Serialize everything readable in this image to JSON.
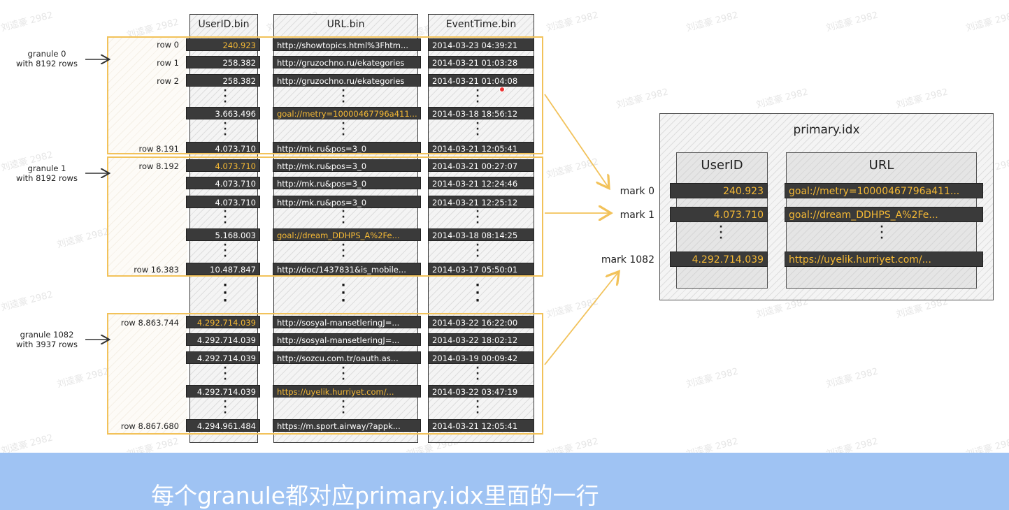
{
  "columns": [
    "UserID.bin",
    "URL.bin",
    "EventTime.bin"
  ],
  "granules": [
    {
      "label_line1": "granule 0",
      "label_line2": "with 8192 rows",
      "rows": [
        {
          "row": "row 0",
          "user": "240.923",
          "url": "http://showtopics.html%3Fhtm...",
          "time": "2014-03-23 04:39:21",
          "hl_user": true,
          "hl_url": false
        },
        {
          "row": "row 1",
          "user": "258.382",
          "url": "http://gruzochno.ru/ekategories",
          "time": "2014-03-21 01:03:28",
          "hl_user": false,
          "hl_url": false
        },
        {
          "row": "row 2",
          "user": "258.382",
          "url": "http://gruzochno.ru/ekategories",
          "time": "2014-03-21 01:04:08",
          "hl_user": false,
          "hl_url": false
        },
        {
          "row": "",
          "user": "3.663.496",
          "url": "goal://metry=10000467796a411...",
          "time": "2014-03-18 18:56:12",
          "hl_user": false,
          "hl_url": true
        },
        {
          "row": "row 8.191",
          "user": "4.073.710",
          "url": "http://mk.ru&pos=3_0",
          "time": "2014-03-21 12:05:41",
          "hl_user": false,
          "hl_url": false
        }
      ]
    },
    {
      "label_line1": "granule 1",
      "label_line2": "with 8192 rows",
      "rows": [
        {
          "row": "row 8.192",
          "user": "4.073.710",
          "url": "http://mk.ru&pos=3_0",
          "time": "2014-03-21 00:27:07",
          "hl_user": true,
          "hl_url": false
        },
        {
          "row": "",
          "user": "4.073.710",
          "url": "http://mk.ru&pos=3_0",
          "time": "2014-03-21 12:24:46",
          "hl_user": false,
          "hl_url": false
        },
        {
          "row": "",
          "user": "4.073.710",
          "url": "http://mk.ru&pos=3_0",
          "time": "2014-03-21 12:25:12",
          "hl_user": false,
          "hl_url": false
        },
        {
          "row": "",
          "user": "5.168.003",
          "url": "goal://dream_DDHPS_A%2Fe...",
          "time": "2014-03-18 08:14:25",
          "hl_user": false,
          "hl_url": true
        },
        {
          "row": "row 16.383",
          "user": "10.487.847",
          "url": "http://doc/1437831&is_mobile...",
          "time": "2014-03-17 05:50:01",
          "hl_user": false,
          "hl_url": false
        }
      ]
    },
    {
      "label_line1": "granule 1082",
      "label_line2": "with 3937 rows",
      "rows": [
        {
          "row": "row 8.863.744",
          "user": "4.292.714.039",
          "url": "http://sosyal-mansetleringJ=...",
          "time": "2014-03-22 16:22:00",
          "hl_user": true,
          "hl_url": false
        },
        {
          "row": "",
          "user": "4.292.714.039",
          "url": "http://sosyal-mansetleringJ=...",
          "time": "2014-03-22 18:02:12",
          "hl_user": false,
          "hl_url": false
        },
        {
          "row": "",
          "user": "4.292.714.039",
          "url": "http://sozcu.com.tr/oauth.as...",
          "time": "2014-03-19 00:09:42",
          "hl_user": false,
          "hl_url": false
        },
        {
          "row": "",
          "user": "4.292.714.039",
          "url": "https://uyelik.hurriyet.com/...",
          "time": "2014-03-22 03:47:19",
          "hl_user": false,
          "hl_url": true
        },
        {
          "row": "row 8.867.680",
          "user": "4.294.961.484",
          "url": "https://m.sport.airway/?appk...",
          "time": "2014-03-21 12:05:41",
          "hl_user": false,
          "hl_url": false
        }
      ]
    }
  ],
  "primary_idx": {
    "title": "primary.idx",
    "columns": [
      "UserID",
      "URL"
    ],
    "marks": [
      {
        "label": "mark 0",
        "user": "240.923",
        "url": "goal://metry=10000467796a411..."
      },
      {
        "label": "mark 1",
        "user": "4.073.710",
        "url": "goal://dream_DDHPS_A%2Fe..."
      },
      {
        "label": "mark 1082",
        "user": "4.292.714.039",
        "url": "https://uyelik.hurriyet.com/..."
      }
    ]
  },
  "caption": "每个granule都对应primary.idx里面的一行",
  "watermark": "刘逵豪 2982",
  "colors": {
    "highlight": "#f5b935",
    "granule_border": "#f2c25a",
    "bar_bg": "#3a3a3a",
    "banner": "#9fc3f3",
    "arrow": "#f2c25a"
  }
}
